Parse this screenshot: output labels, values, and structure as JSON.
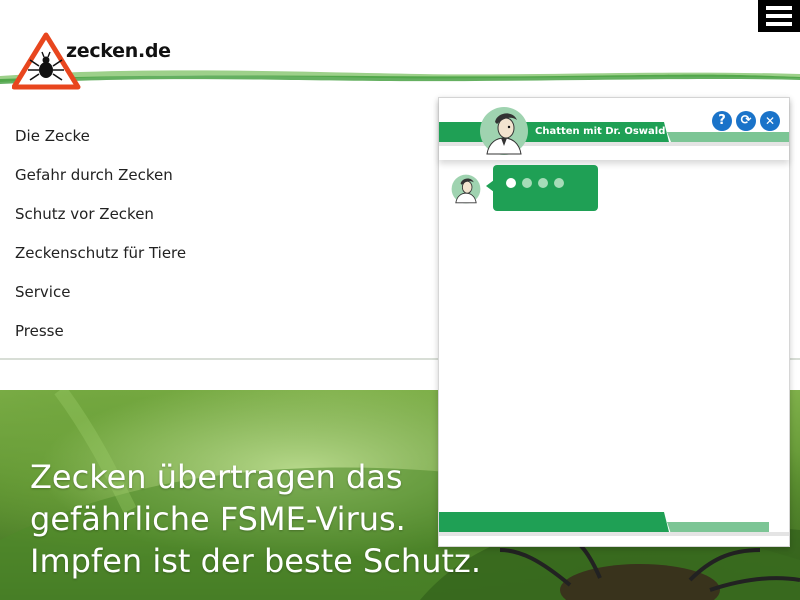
{
  "header": {
    "logo_text": "zecken.de"
  },
  "nav": {
    "items": [
      {
        "label": "Die Zecke"
      },
      {
        "label": "Gefahr durch Zecken"
      },
      {
        "label": "Schutz vor Zecken"
      },
      {
        "label": "Zeckenschutz für Tiere"
      },
      {
        "label": "Service"
      },
      {
        "label": "Presse"
      }
    ]
  },
  "hero": {
    "line1": "Zecken übertragen das",
    "line2": "gefährliche FSME-Virus.",
    "line3": "Impfen ist der beste Schutz."
  },
  "chat": {
    "title": "Chatten mit Dr. Oswald",
    "help_glyph": "?",
    "refresh_glyph": "⟳",
    "close_glyph": "✕",
    "typing_dots": 4
  },
  "colors": {
    "brand_green": "#1fa055",
    "light_green": "#7cc595",
    "warning_red": "#e8461e",
    "button_blue": "#1a73c9"
  },
  "icons": [
    "tick-warning-logo-icon",
    "hamburger-menu-icon",
    "help-icon",
    "refresh-icon",
    "close-icon",
    "doctor-avatar-icon"
  ]
}
